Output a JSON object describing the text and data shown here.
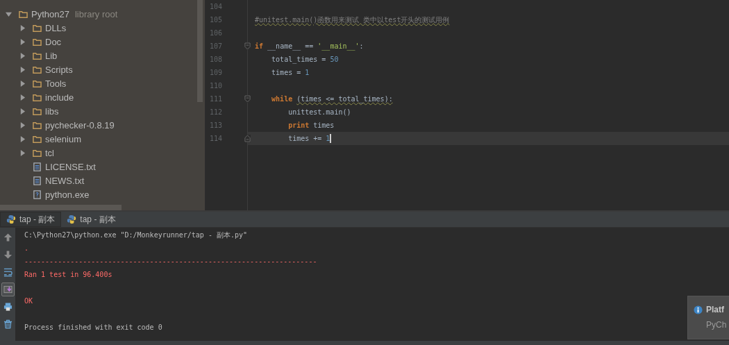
{
  "project_tree": [
    {
      "label": "Python27",
      "hint": "library root",
      "kind": "folder",
      "expanded": true,
      "children": [
        {
          "label": "DLLs",
          "kind": "folder",
          "expanded": false
        },
        {
          "label": "Doc",
          "kind": "folder",
          "expanded": false
        },
        {
          "label": "Lib",
          "kind": "folder",
          "expanded": false
        },
        {
          "label": "Scripts",
          "kind": "folder",
          "expanded": false
        },
        {
          "label": "Tools",
          "kind": "folder",
          "expanded": false
        },
        {
          "label": "include",
          "kind": "folder",
          "expanded": false
        },
        {
          "label": "libs",
          "kind": "folder",
          "expanded": false
        },
        {
          "label": "pychecker-0.8.19",
          "kind": "folder",
          "expanded": false
        },
        {
          "label": "selenium",
          "kind": "folder",
          "expanded": false
        },
        {
          "label": "tcl",
          "kind": "folder",
          "expanded": false
        },
        {
          "label": "LICENSE.txt",
          "kind": "textfile"
        },
        {
          "label": "NEWS.txt",
          "kind": "textfile"
        },
        {
          "label": "python.exe",
          "kind": "unknownfile"
        }
      ]
    }
  ],
  "editor": {
    "lines": [
      {
        "number": "104",
        "current": false
      },
      {
        "number": "105",
        "current": false,
        "tokens": [
          {
            "text": "#unitest.main()函数用来测试 类中以test开头的测试用例",
            "kind": "comment"
          }
        ]
      },
      {
        "number": "106",
        "current": false
      },
      {
        "number": "107",
        "current": false,
        "tokens": [
          {
            "text": "if",
            "kind": "keyword"
          },
          {
            "text": " __name__ == ",
            "kind": "plain"
          },
          {
            "text": "'__main__'",
            "kind": "string"
          },
          {
            "text": ":",
            "kind": "plain"
          }
        ],
        "children": [
          {
            "number": "108",
            "current": false,
            "tokens": [
              {
                "text": "total_times = ",
                "kind": "plain"
              },
              {
                "text": "50",
                "kind": "number"
              }
            ]
          },
          {
            "number": "109",
            "current": false,
            "tokens": [
              {
                "text": "times = ",
                "kind": "plain"
              },
              {
                "text": "1",
                "kind": "number"
              }
            ]
          },
          {
            "number": "110",
            "current": false
          },
          {
            "number": "111",
            "current": false,
            "tokens": [
              {
                "text": "while ",
                "kind": "keyword"
              },
              {
                "text": "(times <= total_times):",
                "kind": "warning"
              }
            ],
            "children": [
              {
                "number": "112",
                "current": false,
                "tokens": [
                  {
                    "text": "unittest.main()",
                    "kind": "plain"
                  }
                ]
              },
              {
                "number": "113",
                "current": false,
                "tokens": [
                  {
                    "text": "print",
                    "kind": "keyword"
                  },
                  {
                    "text": " times",
                    "kind": "plain"
                  }
                ]
              },
              {
                "number": "114",
                "current": true,
                "tokens": [
                  {
                    "text": "times += ",
                    "kind": "plain"
                  },
                  {
                    "text": "1",
                    "kind": "number"
                  }
                ]
              }
            ]
          }
        ]
      }
    ]
  },
  "run_tabs": [
    {
      "label": "tap - 副本",
      "selected": true
    },
    {
      "label": "tap - 副本",
      "selected": false
    }
  ],
  "console_toolbar": [
    {
      "kind": "up",
      "on": false
    },
    {
      "kind": "down",
      "on": false
    },
    {
      "kind": "wrap",
      "on": false
    },
    {
      "kind": "scroll",
      "on": true
    },
    {
      "kind": "print",
      "on": false
    },
    {
      "kind": "trash",
      "on": false
    }
  ],
  "console": [
    {
      "text": "C:\\Python27\\python.exe \"D:/Monkeyrunner/tap - 副本.py\"",
      "kind": "command"
    },
    {
      "text": ".",
      "kind": "error"
    },
    {
      "text": "----------------------------------------------------------------------",
      "kind": "error"
    },
    {
      "text": "Ran 1 test in 96.400s",
      "kind": "error"
    },
    {
      "kind": "blank"
    },
    {
      "text": "OK",
      "kind": "error"
    },
    {
      "kind": "blank"
    },
    {
      "text": "Process finished with exit code 0",
      "kind": "plain"
    }
  ],
  "notification": {
    "title": "Platf",
    "body": "PyCh"
  }
}
